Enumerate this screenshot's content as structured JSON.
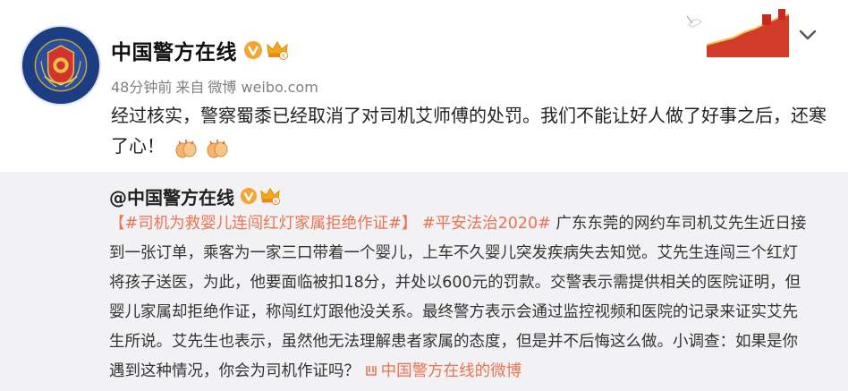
{
  "post": {
    "author": "中国警方在线",
    "time": "48分钟前",
    "from_label": "来自",
    "source": "微博 weibo.com",
    "text": "经过核实，警察蜀黍已经取消了对司机艾师傅的处罚。我们不能让好人做了好事之后，还寒了心！"
  },
  "repost": {
    "author": "@中国警方在线",
    "tag1": "【#司机为救婴儿连闯红灯家属拒绝作证#】",
    "tag2": "#平安法治2020#",
    "body": "广东东莞的网约车司机艾先生近日接到一张订单，乘客为一家三口带着一个婴儿，上车不久婴儿突发疾病失去知觉。艾先生连闯三个红灯将孩子送医，为此，他要面临被扣18分，并处以600元的罚款。交警表示需提供相关的医院证明，但婴儿家属却拒绝作证，称闯红灯跟他没关系。最终警方表示会通过监控视频和医院的记录来证实艾先生所说。艾先生也表示，虽然他无法理解患者家属的态度，但是并不后悔这么做。小调查：如果是你遇到这种情况，你会为司机作证吗？",
    "source_link": "中国警方在线的微博"
  },
  "icons": {
    "avatar": "police-emblem-avatar",
    "verified": "verified-v-icon",
    "member": "crown-member-icon",
    "menu": "chevron-down-icon",
    "emoji": "clapping-hands-emoji",
    "link": "weibo-link-icon"
  },
  "colors": {
    "tag": "#eb7350",
    "verified": "#f3a632",
    "repost_bg": "#f2f2f5"
  }
}
